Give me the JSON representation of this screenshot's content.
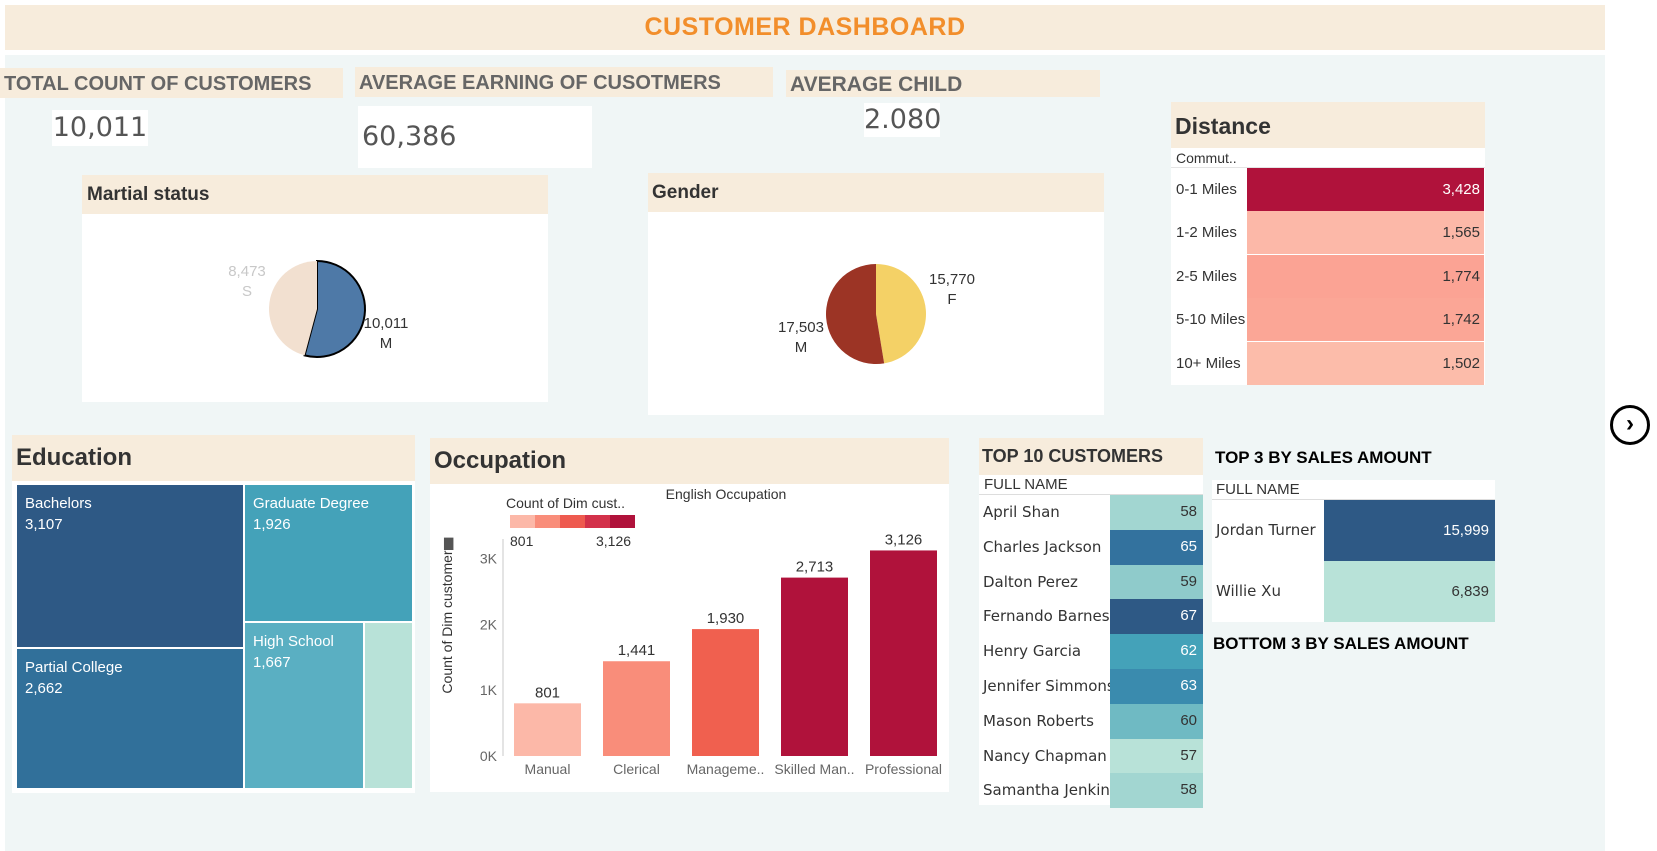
{
  "dashboard": {
    "title": "CUSTOMER DASHBOARD",
    "colors": {
      "title": "#f28e2b",
      "header_bg": "#f7ecdc",
      "canvas_bg": "#f0f6f6"
    }
  },
  "kpis": {
    "total_customers": {
      "label": "TOTAL COUNT OF CUSTOMERS",
      "value": "10,011"
    },
    "average_earning": {
      "label": "AVERAGE EARNING OF CUSOTMERS",
      "value": "60,386"
    },
    "average_child": {
      "label": "AVERAGE CHILD",
      "value": "2.080"
    }
  },
  "marital": {
    "title": "Martial status",
    "slices": [
      {
        "label": "M",
        "value": 10011,
        "display": "10,011",
        "color": "#4e79a7"
      },
      {
        "label": "S",
        "value": 8473,
        "display": "8,473",
        "color": "#f2e0d0"
      }
    ]
  },
  "gender": {
    "title": "Gender",
    "slices": [
      {
        "label": "F",
        "value": 15770,
        "display": "15,770",
        "color": "#f4d166"
      },
      {
        "label": "M",
        "value": 17503,
        "display": "17,503",
        "color": "#9c3425"
      }
    ]
  },
  "distance": {
    "title": "Distance",
    "column_header": "Commut..",
    "rows": [
      {
        "label": "0-1 Miles",
        "value": "3,428",
        "color": "#b0123b"
      },
      {
        "label": "1-2 Miles",
        "value": "1,565",
        "color": "#fcb8a8"
      },
      {
        "label": "2-5 Miles",
        "value": "1,774",
        "color": "#fba394"
      },
      {
        "label": "5-10 Miles",
        "value": "1,742",
        "color": "#fba696"
      },
      {
        "label": "10+ Miles",
        "value": "1,502",
        "color": "#fcbcaa"
      }
    ]
  },
  "education": {
    "title": "Education",
    "cells": [
      {
        "label": "Bachelors",
        "value": "3,107",
        "color": "#2e5985"
      },
      {
        "label": "Graduate Degree",
        "value": "1,926",
        "color": "#44a2b9"
      },
      {
        "label": "Partial College",
        "value": "2,662",
        "color": "#31709a"
      },
      {
        "label": "High School",
        "value": "1,667",
        "color": "#5aafc2"
      },
      {
        "label": "",
        "value": "",
        "color": "#b8e2d8"
      }
    ]
  },
  "occupation": {
    "title": "Occupation",
    "legend_title": "Count of Dim cust..",
    "legend_min": "801",
    "legend_max": "3,126",
    "legend_colors": [
      "#fcb8a8",
      "#f98d7a",
      "#ee5a4f",
      "#d3314a",
      "#b0123b"
    ],
    "axis_title": "English Occupation",
    "y_axis_label": "Count of Dim customer",
    "y_ticks": [
      "0K",
      "1K",
      "2K",
      "3K"
    ]
  },
  "chart_data": {
    "type": "bar",
    "categories": [
      "Manual",
      "Clerical",
      "Manageme..",
      "Skilled Man..",
      "Professional"
    ],
    "values": [
      801,
      1441,
      1930,
      2713,
      3126
    ],
    "value_labels": [
      "801",
      "1,441",
      "1,930",
      "2,713",
      "3,126"
    ],
    "colors": [
      "#fcb8a8",
      "#f98d7a",
      "#f0604f",
      "#b0123b",
      "#b0123b"
    ],
    "title": "English Occupation",
    "ylabel": "Count of Dim customer",
    "ylim": [
      0,
      3300
    ],
    "grid": false
  },
  "top10": {
    "title": "TOP 10 CUSTOMERS",
    "column_header": "FULL NAME",
    "rows": [
      {
        "name": "April Shan",
        "value": "58",
        "color": "#a2d6d1"
      },
      {
        "name": "Charles Jackson",
        "value": "65",
        "color": "#33729e"
      },
      {
        "name": "Dalton Perez",
        "value": "59",
        "color": "#8fcbcb"
      },
      {
        "name": "Fernando Barnes",
        "value": "67",
        "color": "#2e5985"
      },
      {
        "name": "Henry Garcia",
        "value": "62",
        "color": "#44a2b9"
      },
      {
        "name": "Jennifer Simmons",
        "value": "63",
        "color": "#3a8bae"
      },
      {
        "name": "Mason Roberts",
        "value": "60",
        "color": "#6fbac3"
      },
      {
        "name": "Nancy Chapman",
        "value": "57",
        "color": "#b8e2d8"
      },
      {
        "name": "Samantha Jenkins",
        "value": "58",
        "color": "#a2d6d1"
      }
    ]
  },
  "top3": {
    "title": "TOP 3 BY SALES AMOUNT",
    "column_header": "FULL NAME",
    "rows": [
      {
        "name": "Jordan Turner",
        "value": "15,999",
        "color": "#2e5985"
      },
      {
        "name": "Willie Xu",
        "value": "6,839",
        "color": "#b8e2d8"
      }
    ]
  },
  "bottom3": {
    "title": "BOTTOM 3 BY SALES AMOUNT"
  },
  "nav": {
    "next_icon": "chevron-right-icon"
  }
}
